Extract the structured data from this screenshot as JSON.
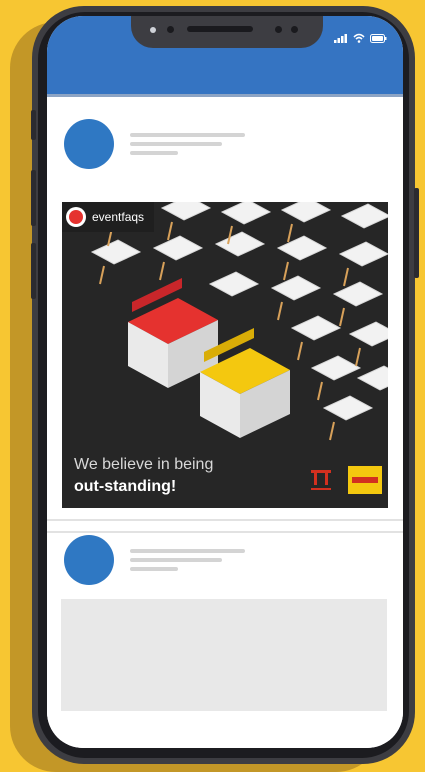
{
  "status_bar": {
    "signal_icon": "signal-bars-icon",
    "wifi_icon": "wifi-icon",
    "battery_icon": "battery-icon"
  },
  "posts": [
    {
      "avatar_color": "#2f78c3",
      "image": {
        "account": "eventfaqs",
        "tagline_line1": "We believe in being",
        "tagline_line2": "out-standing!",
        "accent_red": "#e5322f",
        "accent_yellow": "#f4c80f"
      }
    },
    {
      "avatar_color": "#2f78c3"
    }
  ],
  "colors": {
    "background": "#f7c632",
    "header": "#3574c2",
    "phone_frame": "#3d3d42"
  }
}
